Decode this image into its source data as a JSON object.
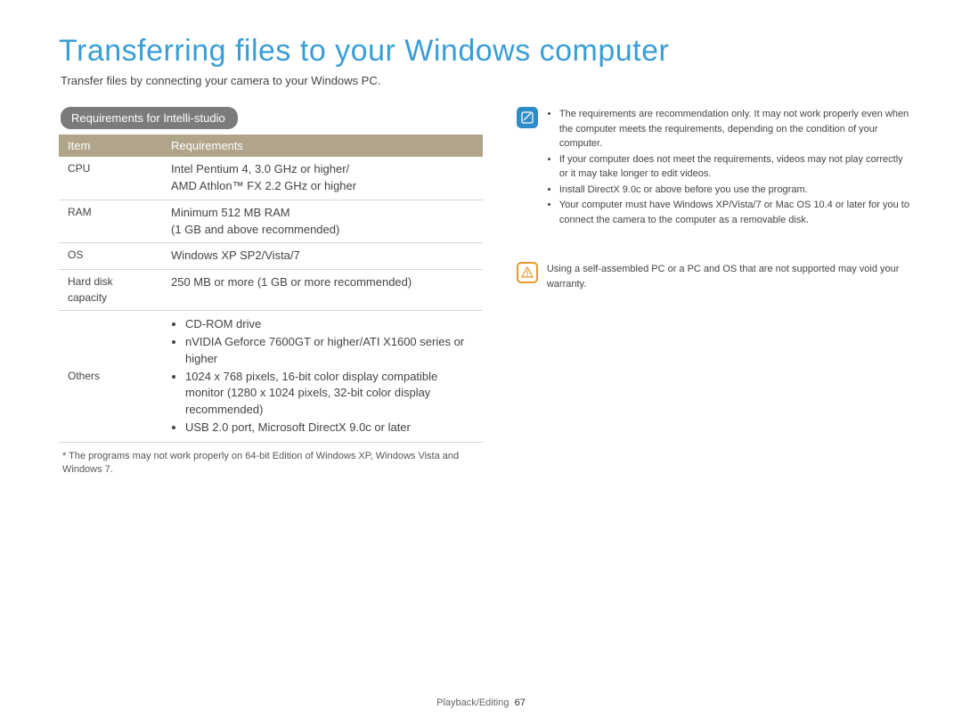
{
  "title": "Transferring files to your Windows computer",
  "intro": "Transfer files by connecting your camera to your Windows PC.",
  "section_heading": "Requirements for Intelli-studio",
  "table": {
    "head_item": "Item",
    "head_req": "Requirements",
    "rows": [
      {
        "item": "CPU",
        "req": "Intel Pentium 4, 3.0 GHz or higher/\nAMD Athlon™ FX 2.2 GHz or higher"
      },
      {
        "item": "RAM",
        "req": "Minimum 512 MB RAM\n(1 GB and above recommended)"
      },
      {
        "item": "OS",
        "req": "Windows XP SP2/Vista/7"
      },
      {
        "item": "Hard disk capacity",
        "req": "250 MB or more (1 GB or more recommended)"
      }
    ],
    "others_item": "Others",
    "others_list": [
      "CD-ROM drive",
      "nVIDIA Geforce 7600GT or higher/ATI X1600 series or higher",
      "1024 x 768 pixels, 16-bit color display compatible monitor (1280 x 1024 pixels, 32-bit color display recommended)",
      "USB 2.0 port, Microsoft DirectX 9.0c or later"
    ]
  },
  "footnote": "* The programs may not work properly on 64-bit Edition of Windows XP, Windows Vista and Windows 7.",
  "note_list": [
    "The requirements are recommendation only. It may not work properly even when the computer meets the requirements, depending on the condition of your computer.",
    "If your computer does not meet the requirements, videos may not play correctly or it may take longer to edit videos.",
    "Install DirectX 9.0c or above before you use the program.",
    "Your computer must have Windows XP/Vista/7 or Mac OS 10.4 or later for you to connect the camera to the computer as a removable disk."
  ],
  "warning": "Using a self-assembled PC or a PC and OS that are not supported may void your warranty.",
  "footer_section": "Playback/Editing",
  "footer_page": "67"
}
